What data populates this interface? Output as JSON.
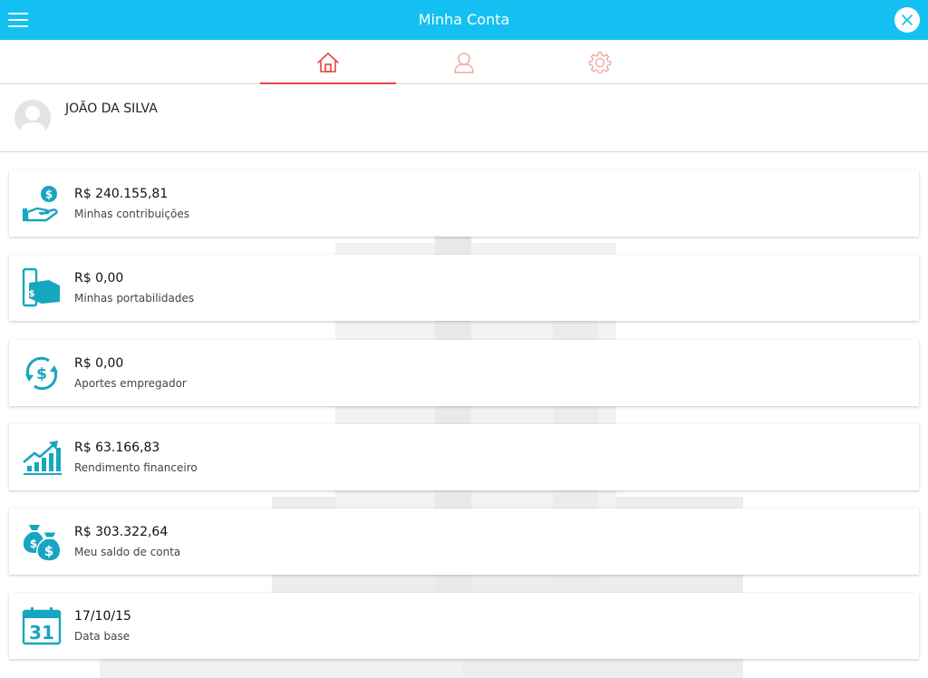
{
  "header": {
    "title": "Minha Conta"
  },
  "profile": {
    "name": "JOÃO DA SILVA"
  },
  "cards": [
    {
      "value": "R$ 240.155,81",
      "label": "Minhas contribuições",
      "icon": "hand-coin-icon"
    },
    {
      "value": "R$ 0,00",
      "label": "Minhas portabilidades",
      "icon": "phone-money-icon"
    },
    {
      "value": "R$ 0,00",
      "label": "Aportes empregador",
      "icon": "dollar-exchange-icon"
    },
    {
      "value": "R$ 63.166,83",
      "label": "Rendimento financeiro",
      "icon": "growth-chart-icon"
    },
    {
      "value": "R$ 303.322,64",
      "label": "Meu saldo de conta",
      "icon": "money-bags-icon"
    },
    {
      "value": "17/10/15",
      "label": "Data base",
      "icon": "calendar-icon"
    }
  ],
  "calendar_day": "31",
  "colors": {
    "header": "#13c0f1",
    "accent": "#e04a3c",
    "icon": "#17a6bf",
    "tab_inactive": "#f0a79f"
  }
}
